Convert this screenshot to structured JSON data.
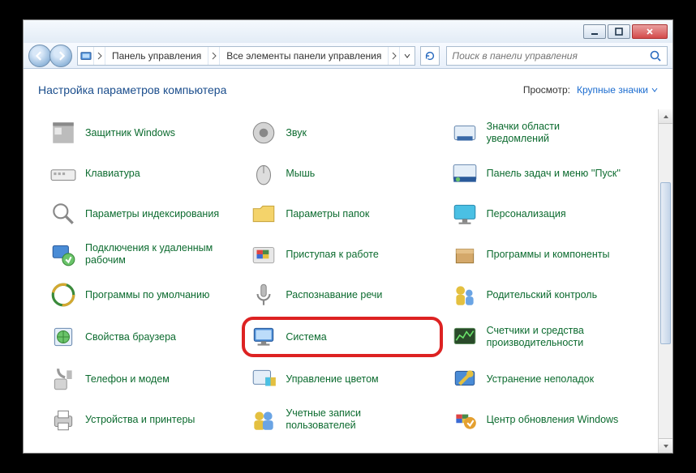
{
  "window": {
    "min_tip": "Свернуть",
    "max_tip": "Развернуть",
    "close_tip": "Закрыть"
  },
  "breadcrumb": {
    "seg1": "Панель управления",
    "seg2": "Все элементы панели управления"
  },
  "search": {
    "placeholder": "Поиск в панели управления"
  },
  "header": {
    "title": "Настройка параметров компьютера",
    "view_label": "Просмотр:",
    "view_value": "Крупные значки"
  },
  "items": [
    {
      "id": "defender",
      "label": "Защитник Windows",
      "icon": "shield"
    },
    {
      "id": "sound",
      "label": "Звук",
      "icon": "speaker"
    },
    {
      "id": "tray",
      "label": "Значки области уведомлений",
      "icon": "tray",
      "clipped": true
    },
    {
      "id": "keyboard",
      "label": "Клавиатура",
      "icon": "keyboard"
    },
    {
      "id": "mouse",
      "label": "Мышь",
      "icon": "mouse"
    },
    {
      "id": "taskbar",
      "label": "Панель задач и меню ''Пуск''",
      "icon": "taskbar"
    },
    {
      "id": "indexing",
      "label": "Параметры индексирования",
      "icon": "search"
    },
    {
      "id": "folder-opts",
      "label": "Параметры папок",
      "icon": "folder"
    },
    {
      "id": "personalize",
      "label": "Персонализация",
      "icon": "monitor"
    },
    {
      "id": "remote",
      "label": "Подключения к удаленным рабочим",
      "icon": "remote"
    },
    {
      "id": "getting-started",
      "label": "Приступая к работе",
      "icon": "flag"
    },
    {
      "id": "programs",
      "label": "Программы и компоненты",
      "icon": "box"
    },
    {
      "id": "defaults",
      "label": "Программы по умолчанию",
      "icon": "defaults"
    },
    {
      "id": "speech",
      "label": "Распознавание речи",
      "icon": "mic"
    },
    {
      "id": "parental",
      "label": "Родительский контроль",
      "icon": "family"
    },
    {
      "id": "inet-opts",
      "label": "Свойства браузера",
      "icon": "globe"
    },
    {
      "id": "system",
      "label": "Система",
      "icon": "computer",
      "highlighted": true
    },
    {
      "id": "perf",
      "label": "Счетчики и средства производительности",
      "icon": "perf"
    },
    {
      "id": "phone",
      "label": "Телефон и модем",
      "icon": "phone"
    },
    {
      "id": "color",
      "label": "Управление цветом",
      "icon": "color"
    },
    {
      "id": "troubleshoot",
      "label": "Устранение неполадок",
      "icon": "wrench"
    },
    {
      "id": "devices",
      "label": "Устройства и принтеры",
      "icon": "printer"
    },
    {
      "id": "users",
      "label": "Учетные записи пользователей",
      "icon": "users"
    },
    {
      "id": "update",
      "label": "Центр обновления Windows",
      "icon": "update"
    }
  ]
}
